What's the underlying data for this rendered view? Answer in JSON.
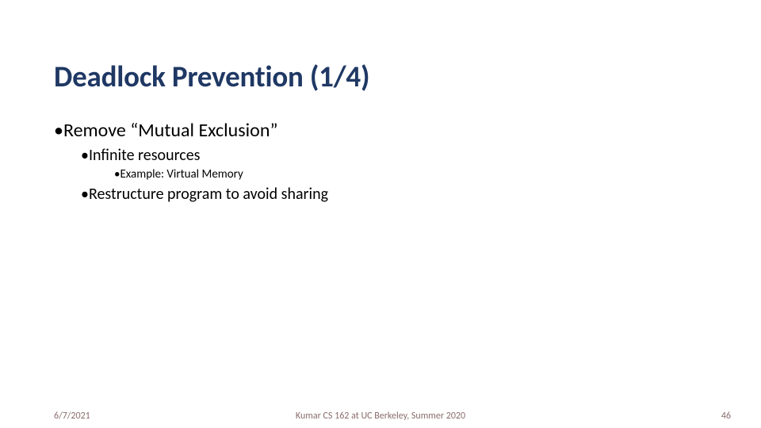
{
  "title": "Deadlock Prevention (1/4)",
  "bullets": {
    "l1": "Remove “Mutual Exclusion”",
    "l2a": "Infinite resources",
    "l3a": "Example: Virtual Memory",
    "l2b": "Restructure program to avoid sharing"
  },
  "footer": {
    "date": "6/7/2021",
    "center": "Kumar CS 162 at UC Berkeley, Summer 2020",
    "page": "46"
  }
}
